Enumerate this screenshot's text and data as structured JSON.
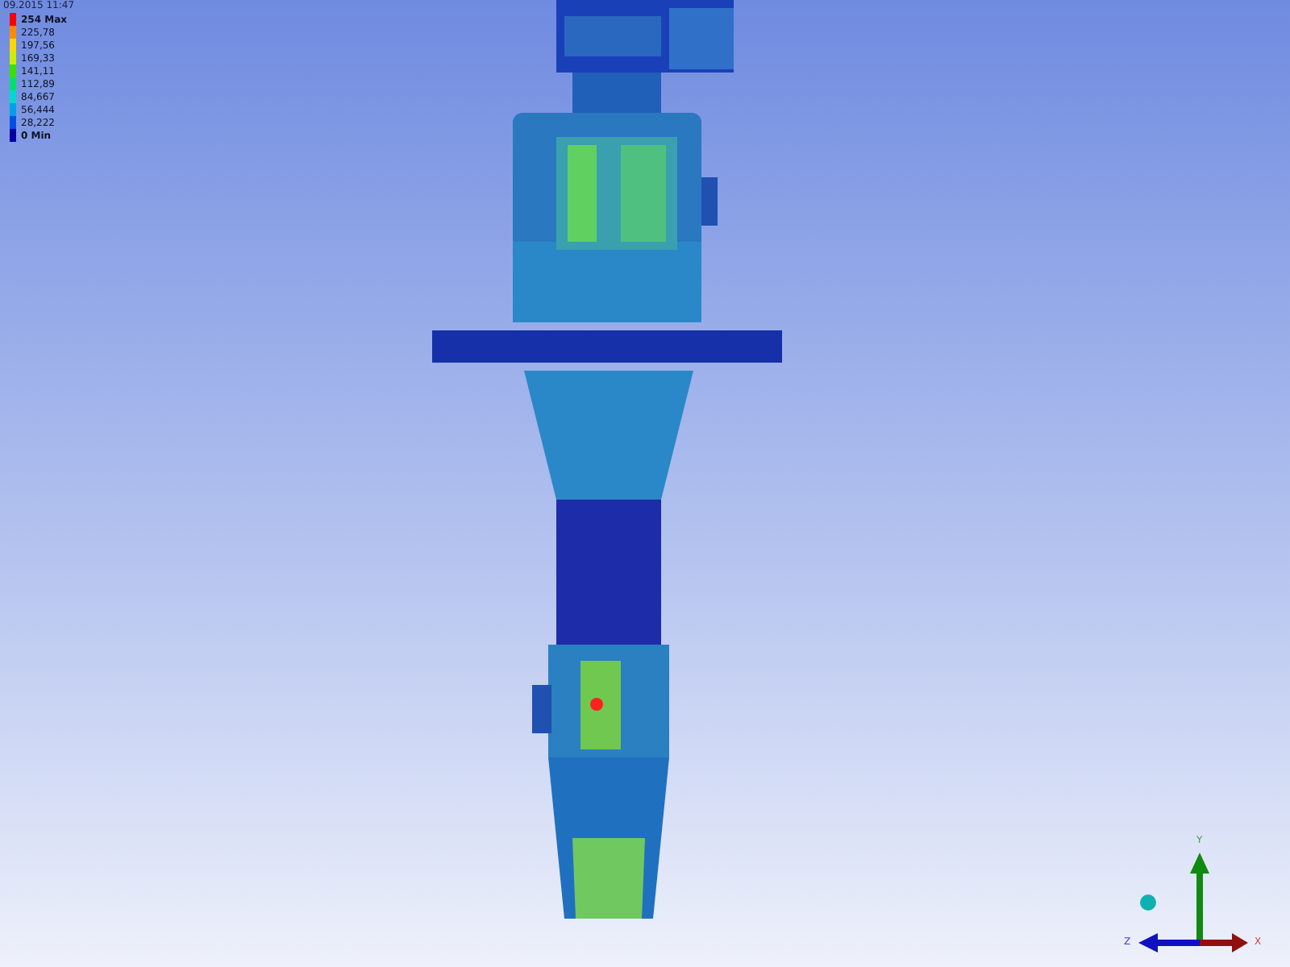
{
  "legend": {
    "timestamp": "09.2015 11:47",
    "bands": [
      {
        "label": "254 Max",
        "color": "#ff0000",
        "kind": "max"
      },
      {
        "label": "225,78",
        "color": "#ff8c00",
        "kind": "value"
      },
      {
        "label": "197,56",
        "color": "#ffd700",
        "kind": "value"
      },
      {
        "label": "169,33",
        "color": "#c8f000",
        "kind": "value"
      },
      {
        "label": "141,11",
        "color": "#38e000",
        "kind": "value"
      },
      {
        "label": "112,89",
        "color": "#00e070",
        "kind": "value"
      },
      {
        "label": "84,667",
        "color": "#00d8d0",
        "kind": "value"
      },
      {
        "label": "56,444",
        "color": "#00a0e8",
        "kind": "value"
      },
      {
        "label": "28,222",
        "color": "#0050e0",
        "kind": "value"
      },
      {
        "label": "0 Min",
        "color": "#0000a0",
        "kind": "min"
      }
    ]
  },
  "triad": {
    "x_label": "X",
    "y_label": "Y",
    "z_label": "Z"
  }
}
